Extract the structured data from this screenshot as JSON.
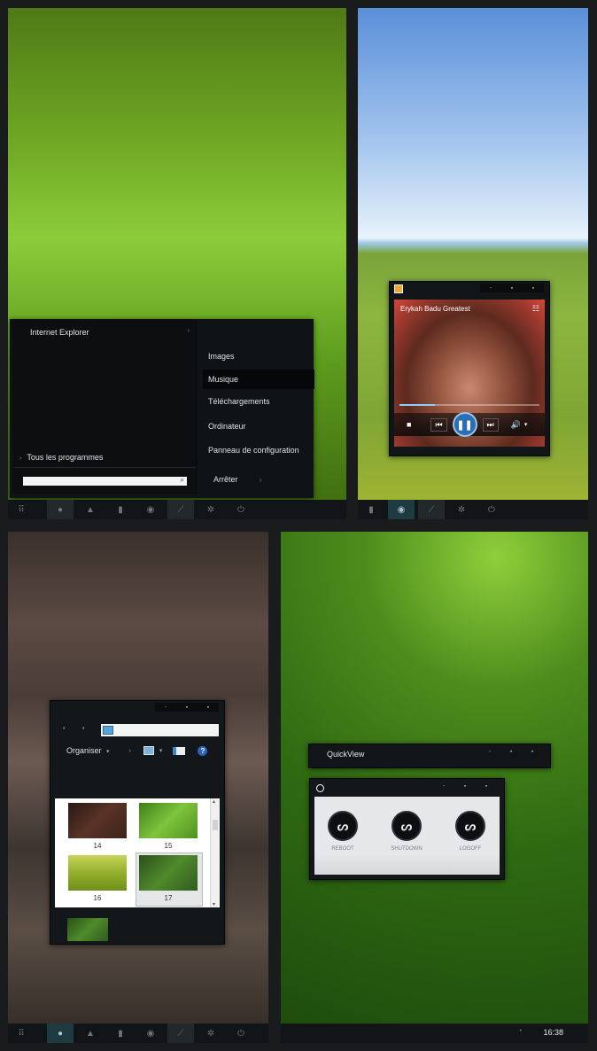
{
  "start_menu": {
    "pinned_app": "Internet Explorer",
    "all_programs": "Tous les programmes",
    "search_placeholder": "",
    "right_items": [
      "Images",
      "Musique",
      "Téléchargements",
      "Ordinateur",
      "Panneau de configuration"
    ],
    "selected_index": 1,
    "shutdown_label": "Arrêter"
  },
  "media_player": {
    "title": "Erykah Badu Greatest",
    "progress": 0.25
  },
  "explorer": {
    "organize_label": "Organiser",
    "thumbnails": [
      {
        "label": "14",
        "color": "#4a2c22"
      },
      {
        "label": "15",
        "color": "#5fa02b"
      },
      {
        "label": "16",
        "color": "#93b32b"
      },
      {
        "label": "17",
        "color": "#3d6b22"
      }
    ],
    "selected_index": 3
  },
  "quickview": {
    "title": "QuickView",
    "buttons": [
      "REBOOT",
      "SHUTDOWN",
      "LOGOFF"
    ]
  },
  "clock": {
    "time": "16:38"
  },
  "colors": {
    "taskbar": "#121517",
    "window": "#16191b",
    "accent": "#1d3b40",
    "selected": "#060708"
  }
}
